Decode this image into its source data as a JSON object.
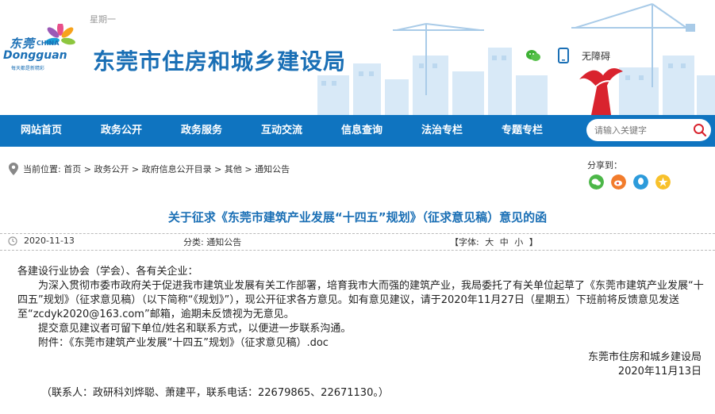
{
  "header": {
    "date_strip": "星期一",
    "logo": {
      "cn": "东莞",
      "china": "CHINA",
      "en": "Dongguan",
      "slogan": "每天都是新精彩"
    },
    "site_title": "东莞市住房和城乡建设局",
    "accessibility_label": "无障碍"
  },
  "nav": {
    "items": [
      "网站首页",
      "政务公开",
      "政务服务",
      "互动交流",
      "信息查询",
      "法治专栏",
      "专题专栏"
    ],
    "search_placeholder": "请输入关键字"
  },
  "breadcrumb": {
    "label": "当前位置:",
    "items": [
      "首页",
      "政务公开",
      "政府信息公开目录",
      "其他",
      "通知公告"
    ],
    "separator": " > "
  },
  "share": {
    "label": "分享到："
  },
  "article": {
    "title": "关于征求《东莞市建筑产业发展“十四五”规划》（征求意见稿）意见的函",
    "date": "2020-11-13",
    "category_label": "分类:",
    "category": "通知公告",
    "font_label": "【字体:",
    "font_large": "大",
    "font_medium": "中",
    "font_small": "小",
    "font_close": "】",
    "salutation": "各建设行业协会（学会）、各有关企业：",
    "paragraph1": "为深入贯彻市委市政府关于促进我市建筑业发展有关工作部署，培育我市大而强的建筑产业，我局委托了有关单位起草了《东莞市建筑产业发展“十四五”规划》（征求意见稿）（以下简称“《规划》”），现公开征求各方意见。如有意见建议，请于2020年11月27日（星期五）下班前将反馈意见发送至“zcdyk2020@163.com”邮箱，逾期未反馈视为无意见。",
    "paragraph2": "提交意见建议者可留下单位/姓名和联系方式，以便进一步联系沟通。",
    "attachment": "附件：《东莞市建筑产业发展“十四五”规划》（征求意见稿）.doc",
    "signature": "东莞市住房和城乡建设局",
    "signature_date": "2020年11月13日",
    "contact": "（联系人：政研科刘烨聪、萧建平，联系电话：22679865、22671130。）"
  },
  "colors": {
    "brand_blue": "#1a6fb5",
    "nav_blue": "#0f74c0",
    "search_red": "#d9232e"
  }
}
